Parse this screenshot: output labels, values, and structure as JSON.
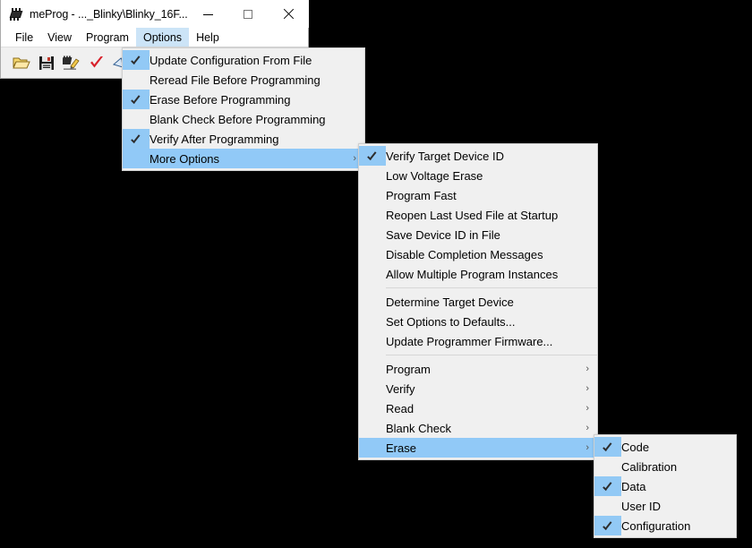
{
  "window": {
    "title": "meProg - ..._Blinky\\Blinky_16F...",
    "app_icon": "chip-icon",
    "controls": {
      "minimize": "minimize-icon",
      "maximize": "maximize-icon",
      "close": "close-icon"
    }
  },
  "menubar": {
    "items": [
      {
        "label": "File",
        "active": false
      },
      {
        "label": "View",
        "active": false
      },
      {
        "label": "Program",
        "active": false
      },
      {
        "label": "Options",
        "active": true
      },
      {
        "label": "Help",
        "active": false
      }
    ]
  },
  "toolbar": {
    "buttons": [
      {
        "name": "open-file-icon",
        "title": "Open File"
      },
      {
        "name": "save-file-icon",
        "title": "Save File"
      },
      {
        "name": "program-device-icon",
        "title": "Program Device"
      },
      {
        "name": "verify-checkmark-icon",
        "title": "Verify"
      },
      {
        "name": "read-device-icon",
        "title": "Read Device"
      },
      {
        "name": "blank-check-bulb-icon",
        "title": "Blank Check"
      }
    ]
  },
  "menus": {
    "options": {
      "name": "options-menu",
      "items": [
        {
          "label": "Update Configuration From File",
          "checked": true,
          "selected": false,
          "submenu": false
        },
        {
          "label": "Reread File Before Programming",
          "checked": false,
          "selected": false,
          "submenu": false
        },
        {
          "label": "Erase Before Programming",
          "checked": true,
          "selected": false,
          "submenu": false
        },
        {
          "label": "Blank Check Before Programming",
          "checked": false,
          "selected": false,
          "submenu": false
        },
        {
          "label": "Verify After Programming",
          "checked": true,
          "selected": false,
          "submenu": false
        },
        {
          "label": "More Options",
          "checked": false,
          "selected": true,
          "submenu": true
        }
      ]
    },
    "more_options": {
      "name": "more-options-menu",
      "groups": [
        {
          "items": [
            {
              "label": "Verify Target Device ID",
              "checked": true,
              "selected": false,
              "submenu": false
            },
            {
              "label": "Low Voltage Erase",
              "checked": false,
              "selected": false,
              "submenu": false
            },
            {
              "label": "Program Fast",
              "checked": false,
              "selected": false,
              "submenu": false
            },
            {
              "label": "Reopen Last Used File at Startup",
              "checked": false,
              "selected": false,
              "submenu": false
            },
            {
              "label": "Save Device ID in File",
              "checked": false,
              "selected": false,
              "submenu": false
            },
            {
              "label": "Disable Completion Messages",
              "checked": false,
              "selected": false,
              "submenu": false
            },
            {
              "label": "Allow Multiple Program Instances",
              "checked": false,
              "selected": false,
              "submenu": false
            }
          ]
        },
        {
          "items": [
            {
              "label": "Determine Target Device",
              "checked": false,
              "selected": false,
              "submenu": false
            },
            {
              "label": "Set Options to Defaults...",
              "checked": false,
              "selected": false,
              "submenu": false
            },
            {
              "label": "Update Programmer Firmware...",
              "checked": false,
              "selected": false,
              "submenu": false
            }
          ]
        },
        {
          "items": [
            {
              "label": "Program",
              "checked": false,
              "selected": false,
              "submenu": true
            },
            {
              "label": "Verify",
              "checked": false,
              "selected": false,
              "submenu": true
            },
            {
              "label": "Read",
              "checked": false,
              "selected": false,
              "submenu": true
            },
            {
              "label": "Blank Check",
              "checked": false,
              "selected": false,
              "submenu": true
            },
            {
              "label": "Erase",
              "checked": false,
              "selected": true,
              "submenu": true
            }
          ]
        }
      ]
    },
    "erase": {
      "name": "erase-submenu",
      "items": [
        {
          "label": "Code",
          "checked": true,
          "selected": false,
          "submenu": false
        },
        {
          "label": "Calibration",
          "checked": false,
          "selected": false,
          "submenu": false
        },
        {
          "label": "Data",
          "checked": true,
          "selected": false,
          "submenu": false
        },
        {
          "label": "User ID",
          "checked": false,
          "selected": false,
          "submenu": false
        },
        {
          "label": "Configuration",
          "checked": true,
          "selected": false,
          "submenu": false
        }
      ]
    }
  },
  "colors": {
    "menu_background": "#f0f0f0",
    "highlight": "#91c9f7",
    "check_background": "#92c9f5",
    "menubar_active": "#cce4f7",
    "desktop": "#000000"
  },
  "icons": {
    "submenu_arrow": "chevron-right-icon"
  }
}
